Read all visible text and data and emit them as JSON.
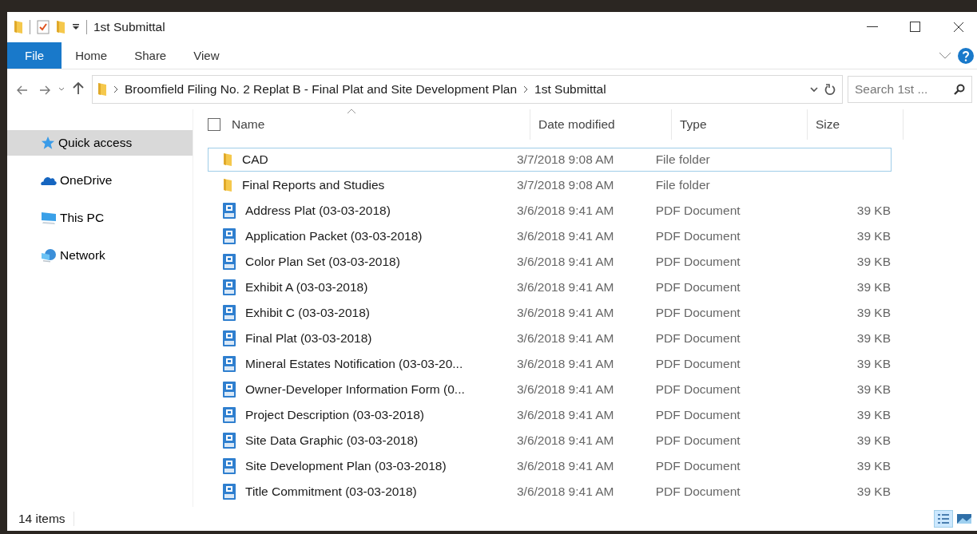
{
  "window": {
    "title": "1st Submittal"
  },
  "ribbon_tabs": [
    {
      "label": "File",
      "selected": true
    },
    {
      "label": "Home",
      "selected": false
    },
    {
      "label": "Share",
      "selected": false
    },
    {
      "label": "View",
      "selected": false
    }
  ],
  "address_bar": {
    "path": [
      {
        "label": "Broomfield Filing No. 2 Replat B - Final Plat and Site Development Plan"
      },
      {
        "label": "1st Submittal"
      }
    ]
  },
  "search": {
    "placeholder": "Search 1st ..."
  },
  "sidebar": {
    "items": [
      {
        "label": "Quick access",
        "kind": "star",
        "selected": true
      },
      {
        "label": "OneDrive",
        "kind": "cloud",
        "selected": false
      },
      {
        "label": "This PC",
        "kind": "pc",
        "selected": false
      },
      {
        "label": "Network",
        "kind": "network",
        "selected": false
      }
    ]
  },
  "table": {
    "select_all_checked": false,
    "columns": [
      "Name",
      "Date modified",
      "Type",
      "Size"
    ],
    "rows": [
      {
        "kind": "folder",
        "name": "CAD",
        "date": "3/7/2018 9:08 AM",
        "type": "File folder",
        "focused": true
      },
      {
        "kind": "folder",
        "name": "Final Reports and Studies",
        "date": "3/7/2018 9:08 AM",
        "type": "File folder",
        "focused": false
      },
      {
        "kind": "pdf",
        "name": "Address Plat (03-03-2018)",
        "date": "3/6/2018 9:41 AM",
        "type": "PDF Document",
        "size": "39 KB",
        "focused": false
      },
      {
        "kind": "pdf",
        "name": "Application Packet (03-03-2018)",
        "date": "3/6/2018 9:41 AM",
        "type": "PDF Document",
        "size": "39 KB",
        "focused": false
      },
      {
        "kind": "pdf",
        "name": "Color Plan Set (03-03-2018)",
        "date": "3/6/2018 9:41 AM",
        "type": "PDF Document",
        "size": "39 KB",
        "focused": false
      },
      {
        "kind": "pdf",
        "name": "Exhibit A (03-03-2018)",
        "date": "3/6/2018 9:41 AM",
        "type": "PDF Document",
        "size": "39 KB",
        "focused": false
      },
      {
        "kind": "pdf",
        "name": "Exhibit C (03-03-2018)",
        "date": "3/6/2018 9:41 AM",
        "type": "PDF Document",
        "size": "39 KB",
        "focused": false
      },
      {
        "kind": "pdf",
        "name": "Final Plat (03-03-2018)",
        "date": "3/6/2018 9:41 AM",
        "type": "PDF Document",
        "size": "39 KB",
        "focused": false
      },
      {
        "kind": "pdf",
        "name": "Mineral Estates Notification (03-03-20...",
        "date": "3/6/2018 9:41 AM",
        "type": "PDF Document",
        "size": "39 KB",
        "focused": false
      },
      {
        "kind": "pdf",
        "name": "Owner-Developer Information Form (0...",
        "date": "3/6/2018 9:41 AM",
        "type": "PDF Document",
        "size": "39 KB",
        "focused": false
      },
      {
        "kind": "pdf",
        "name": "Project Description (03-03-2018)",
        "date": "3/6/2018 9:41 AM",
        "type": "PDF Document",
        "size": "39 KB",
        "focused": false
      },
      {
        "kind": "pdf",
        "name": "Site Data Graphic (03-03-2018)",
        "date": "3/6/2018 9:41 AM",
        "type": "PDF Document",
        "size": "39 KB",
        "focused": false
      },
      {
        "kind": "pdf",
        "name": "Site Development Plan (03-03-2018)",
        "date": "3/6/2018 9:41 AM",
        "type": "PDF Document",
        "size": "39 KB",
        "focused": false
      },
      {
        "kind": "pdf",
        "name": "Title Commitment (03-03-2018)",
        "date": "3/6/2018 9:41 AM",
        "type": "PDF Document",
        "size": "39 KB",
        "focused": false
      }
    ]
  },
  "status_bar": {
    "count": "14 items"
  }
}
